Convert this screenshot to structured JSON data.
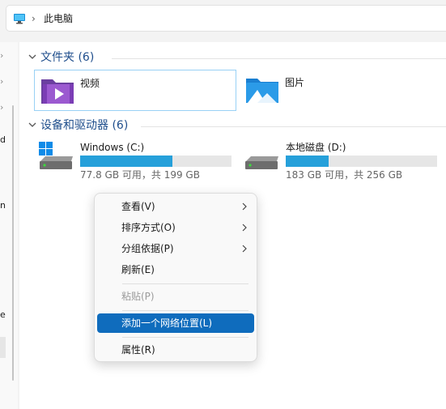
{
  "address_bar": {
    "icon": "this-pc-icon",
    "chevron": "›",
    "location": "此电脑"
  },
  "nav_pane": {
    "label_fragments": [
      "d",
      "n",
      "e"
    ]
  },
  "groups": {
    "folders": {
      "title": "文件夹 (6)",
      "items": [
        {
          "label": "视频",
          "icon": "videos-folder-icon",
          "selected": true
        },
        {
          "label": "图片",
          "icon": "pictures-folder-icon",
          "selected": false
        }
      ]
    },
    "drives": {
      "title": "设备和驱动器 (6)",
      "items": [
        {
          "name": "Windows (C:)",
          "icon": "system-drive-icon",
          "space": "77.8 GB 可用，共 199 GB",
          "used_fraction": 0.609
        },
        {
          "name": "本地磁盘 (D:)",
          "icon": "local-drive-icon",
          "space": "183 GB 可用，共 256 GB",
          "used_fraction": 0.285
        }
      ]
    }
  },
  "context_menu": {
    "items": [
      {
        "label": "查看(V)",
        "submenu": true
      },
      {
        "label": "排序方式(O)",
        "submenu": true
      },
      {
        "label": "分组依据(P)",
        "submenu": true
      },
      {
        "label": "刷新(E)"
      },
      {
        "label": "粘贴(P)",
        "disabled": true
      },
      {
        "label": "添加一个网络位置(L)",
        "highlighted": true
      },
      {
        "label": "属性(R)"
      }
    ]
  },
  "colors": {
    "accent": "#0f6cbd",
    "drive_bar": "#26a0da",
    "group_title": "#1f4e8c",
    "selection_border": "#99d1f5"
  }
}
